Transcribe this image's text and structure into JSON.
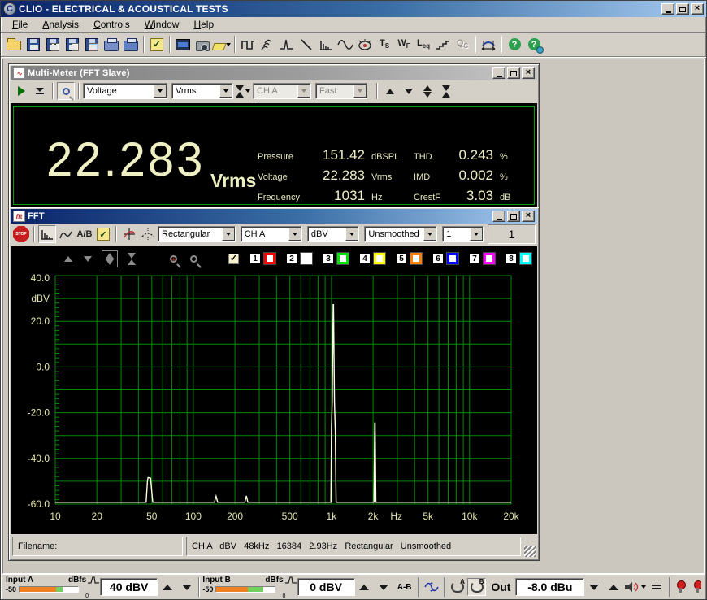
{
  "window": {
    "title": "CLIO - ELECTRICAL & ACOUSTICAL TESTS"
  },
  "menu": {
    "items": [
      "File",
      "Analysis",
      "Controls",
      "Window",
      "Help"
    ]
  },
  "toolbar": {
    "ts": {
      "main": "T",
      "sub": "S"
    },
    "wf": {
      "main": "W",
      "sub": "F"
    },
    "leq": {
      "main": "L",
      "sub": "eq"
    },
    "qc": {
      "main": "Q",
      "sub": "C"
    }
  },
  "mm": {
    "title": "Multi-Meter (FFT Slave)",
    "toolbar": {
      "param": "Voltage",
      "unit": "Vrms",
      "channel": "CH A",
      "speed": "Fast"
    },
    "display": {
      "value": "22.283",
      "unit": "Vrms",
      "rows": [
        {
          "label": "Pressure",
          "value": "151.42",
          "unit": "dBSPL",
          "label2": "THD",
          "value2": "0.243",
          "unit2": "%"
        },
        {
          "label": "Voltage",
          "value": "22.283",
          "unit": "Vrms",
          "label2": "IMD",
          "value2": "0.002",
          "unit2": "%"
        },
        {
          "label": "Frequency",
          "value": "1031",
          "unit": "Hz",
          "label2": "CrestF",
          "value2": "3.03",
          "unit2": "dB"
        }
      ]
    }
  },
  "fft": {
    "title": "FFT",
    "toolbar": {
      "stop": "STOP",
      "ab": "A/B",
      "window": "Rectangular",
      "channel": "CH A",
      "unit": "dBV",
      "smoothing": "Unsmoothed",
      "averages": "1",
      "avg_display": "1"
    },
    "plot": {
      "check": "✓",
      "slots": [
        {
          "n": "1",
          "color": "#FF0000"
        },
        {
          "n": "2",
          "color": "#FFFFFF"
        },
        {
          "n": "3",
          "color": "#00E000"
        },
        {
          "n": "4",
          "color": "#FFFF00"
        },
        {
          "n": "5",
          "color": "#FF8000"
        },
        {
          "n": "6",
          "color": "#0000FF"
        },
        {
          "n": "7",
          "color": "#FF00FF"
        },
        {
          "n": "8",
          "color": "#00FFFF"
        }
      ]
    },
    "status": {
      "filename_label": "Filename:",
      "info": "CH A   dBV   48kHz   16384   2.93Hz   Rectangular   Unsmoothed"
    }
  },
  "bottom": {
    "input_a": {
      "label": "Input A",
      "unit": "dBfs",
      "min": "-50",
      "zero": "0",
      "gain": "40 dBV",
      "orange_pct": 63,
      "green_pct": 11
    },
    "input_b": {
      "label": "Input B",
      "unit": "dBfs",
      "min": "-50",
      "zero": "0",
      "gain": "0 dBV",
      "orange_pct": 54,
      "green_pct": 26
    },
    "ab_label": "A-B",
    "loop_a": "A",
    "loop_b": "B",
    "out_label": "Out",
    "out_level": "-8.0 dBu"
  },
  "chart_data": {
    "type": "line",
    "title": "FFT spectrum, CH A",
    "xlabel": "Hz",
    "ylabel": "dBV",
    "x_scale": "log",
    "xlim": [
      10,
      20000
    ],
    "ylim": [
      -60,
      40
    ],
    "grid": true,
    "x_ticks": [
      {
        "v": 10,
        "label": "10"
      },
      {
        "v": 20,
        "label": "20"
      },
      {
        "v": 50,
        "label": "50"
      },
      {
        "v": 100,
        "label": "100"
      },
      {
        "v": 200,
        "label": "200"
      },
      {
        "v": 500,
        "label": "500"
      },
      {
        "v": 1000,
        "label": "1k"
      },
      {
        "v": 2000,
        "label": "2k"
      },
      {
        "v": 5000,
        "label": "5k"
      },
      {
        "v": 10000,
        "label": "10k"
      },
      {
        "v": 20000,
        "label": "20k"
      }
    ],
    "x_unit_label": {
      "v": 2950,
      "label": "Hz"
    },
    "y_ticks": [
      {
        "v": 40,
        "label": "40.0"
      },
      {
        "v": 20,
        "label": "20.0"
      },
      {
        "v": 0,
        "label": "0.0"
      },
      {
        "v": -20,
        "label": "-20.0"
      },
      {
        "v": -40,
        "label": "-40.0"
      },
      {
        "v": -60,
        "label": "-60.0"
      }
    ],
    "grid_color": "#008A00",
    "label_color": "#E4E4AC",
    "series": [
      {
        "name": "CH A",
        "color": "#FFFFE6",
        "points": [
          [
            10,
            -59.2
          ],
          [
            45.5,
            -59.2
          ],
          [
            46.5,
            -50
          ],
          [
            47,
            -48.4
          ],
          [
            49,
            -48.7
          ],
          [
            49.6,
            -52.5
          ],
          [
            50.2,
            -56
          ],
          [
            50.8,
            -59.2
          ],
          [
            142,
            -59.2
          ],
          [
            146,
            -56.6
          ],
          [
            150,
            -59.2
          ],
          [
            236,
            -59.2
          ],
          [
            242,
            -56.4
          ],
          [
            248,
            -59.2
          ],
          [
            990,
            -59.2
          ],
          [
            1000,
            -26
          ],
          [
            1012,
            -15.5
          ],
          [
            1029,
            27.3
          ],
          [
            1035,
            27.3
          ],
          [
            1052,
            -15.5
          ],
          [
            1066,
            -28
          ],
          [
            1080,
            -59.2
          ],
          [
            2030,
            -59.2
          ],
          [
            2056,
            -24.6
          ],
          [
            2070,
            -24.6
          ],
          [
            2095,
            -59.2
          ],
          [
            20000,
            -59.2
          ]
        ]
      }
    ]
  }
}
